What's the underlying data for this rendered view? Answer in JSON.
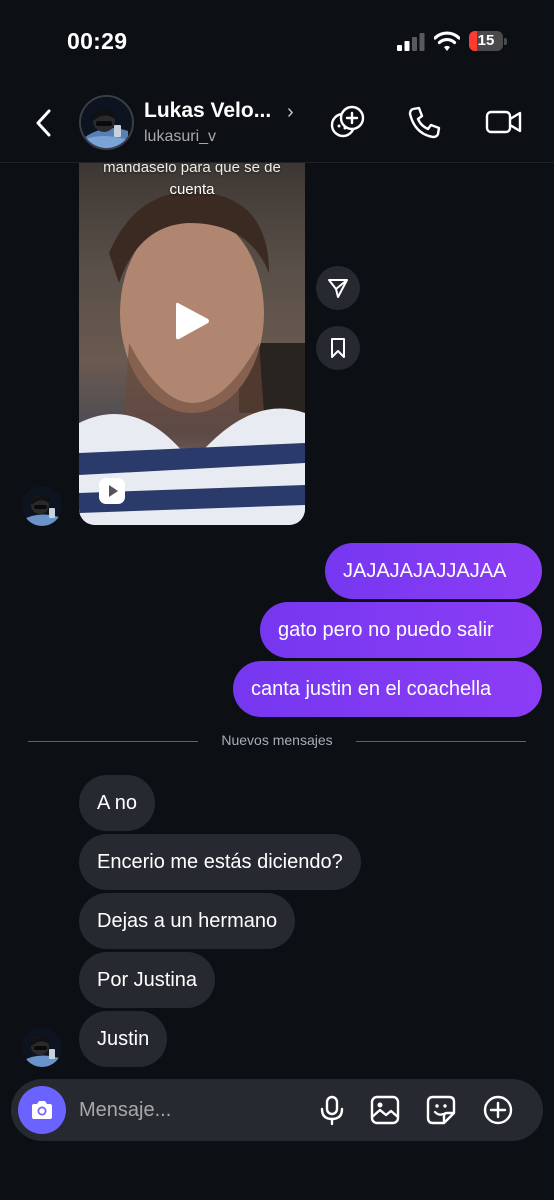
{
  "status_bar": {
    "time": "00:29",
    "battery": "15"
  },
  "header": {
    "name": "Lukas Velo...",
    "username": "lukasuri_v"
  },
  "video": {
    "caption_cut": "mandaselo para que se de",
    "caption": "cuenta"
  },
  "messages_out": [
    "JAJAJAJAJJAJAA",
    "gato pero no puedo salir",
    "canta justin en el coachella"
  ],
  "divider": "Nuevos mensajes",
  "messages_in": [
    "A no",
    "Encerio me estás diciendo?",
    "Dejas a un hermano",
    "Por Justina",
    "Justin"
  ],
  "composer": {
    "placeholder": "Mensaje..."
  },
  "colors": {
    "outgoing": "#7a35f2",
    "incoming": "#262a30",
    "camera": "#6b63ff",
    "background": "#0c1014"
  }
}
